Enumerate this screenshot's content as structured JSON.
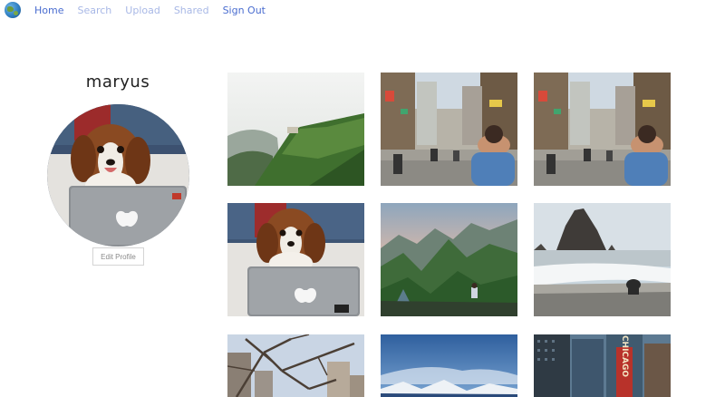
{
  "nav": {
    "items": [
      {
        "label": "Home",
        "state": "active"
      },
      {
        "label": "Search",
        "state": "inactive"
      },
      {
        "label": "Upload",
        "state": "inactive"
      },
      {
        "label": "Shared",
        "state": "inactive"
      },
      {
        "label": "Sign Out",
        "state": "active"
      }
    ]
  },
  "profile": {
    "username": "maryus",
    "edit_label": "Edit Profile"
  },
  "photos": [
    {
      "subject": "misty green mountain with terraces"
    },
    {
      "subject": "busy city street with motorbikes"
    },
    {
      "subject": "busy city street with motorbikes"
    },
    {
      "subject": "dog behind laptop"
    },
    {
      "subject": "limestone karst mountains with hiker"
    },
    {
      "subject": "beach with sea stack and child"
    },
    {
      "subject": "bare branches against city skyline"
    },
    {
      "subject": "blue sky over snowy mountains"
    },
    {
      "subject": "city buildings with Chicago theatre sign"
    }
  ],
  "sign_text": "CHICAGO",
  "colors": {
    "nav_active": "#4a6dd0",
    "nav_inactive": "#a8b8e6"
  }
}
